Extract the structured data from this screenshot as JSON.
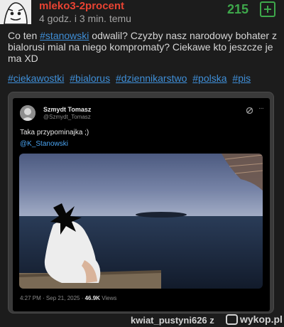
{
  "post": {
    "author": "mleko3-2procent",
    "time": "4 godz. i 3 min. temu",
    "votes": "215",
    "body": {
      "pre": "Co ten ",
      "link": "#stanowski",
      "post": " odwalil? Czyzby nasz narodowy bohater z bialorusi mial na niego kompromaty? Ciekawe kto jeszcze je ma XD"
    },
    "tags": [
      "#ciekawostki",
      "#bialorus",
      "#dziennikarstwo",
      "#polska",
      "#pis"
    ]
  },
  "tweet": {
    "name": "Szmydt Tomasz",
    "handle": "@Szmydt_Tomasz",
    "text": "Taka przypominajka ;)",
    "mention": "@K_Stanowski",
    "time": "4:27 PM · Sep 21, 2025 · ",
    "views_count": "46.9K",
    "views_label": "Views"
  },
  "footer": {
    "username": "kwiat_pustyni626",
    "separator": "z",
    "logo_text": "wykop.pl"
  },
  "colors": {
    "author": "#e84332",
    "votes": "#3ea84b",
    "link": "#3f8fd8",
    "background": "#1c1c1c"
  },
  "icons": {
    "avatar": "cartoon-face-avatar",
    "plus": "plus-square-icon",
    "grok": "grok-icon",
    "more": "more-dots-icon",
    "logo": "wykop-logo-icon"
  }
}
